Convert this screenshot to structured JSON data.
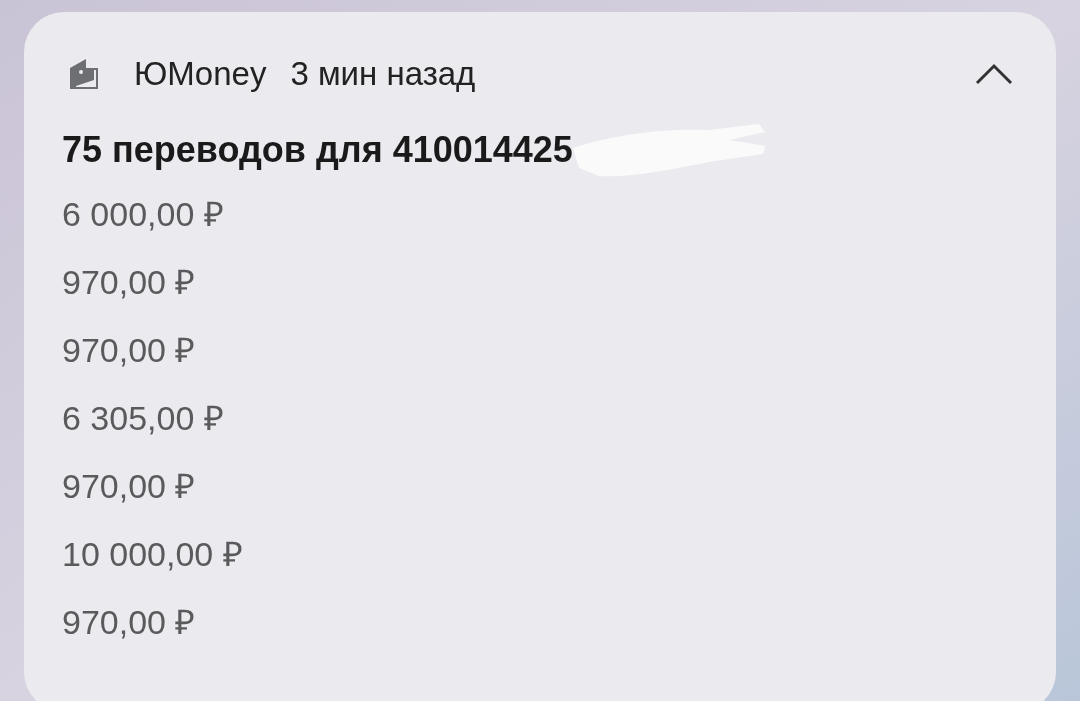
{
  "notification": {
    "app_name": "ЮMoney",
    "time": "3 мин назад",
    "expanded": true,
    "title": "75 переводов для 410014425",
    "amounts": [
      "6 000,00 ₽",
      "970,00 ₽",
      "970,00 ₽",
      "6 305,00 ₽",
      "970,00 ₽",
      "10 000,00 ₽",
      "970,00 ₽"
    ]
  }
}
